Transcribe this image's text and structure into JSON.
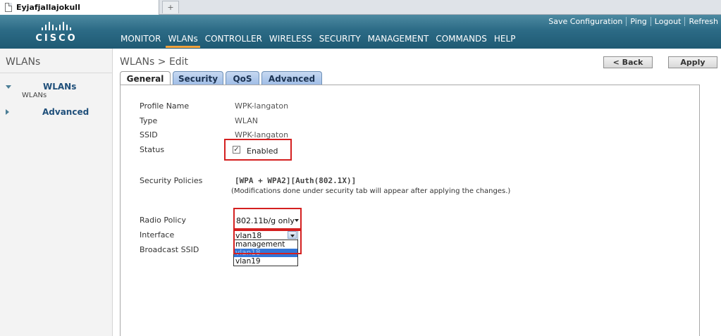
{
  "browser": {
    "tab_title": "Eyjafjallajokull",
    "new_tab_glyph": "+"
  },
  "header": {
    "logo_text": "CISCO",
    "top_links": [
      "Save Configuration",
      "Ping",
      "Logout",
      "Refresh"
    ],
    "nav": [
      "MONITOR",
      "WLANs",
      "CONTROLLER",
      "WIRELESS",
      "SECURITY",
      "MANAGEMENT",
      "COMMANDS",
      "HELP"
    ],
    "active_nav": "WLANs",
    "accent_color": "#f3a23b"
  },
  "sidebar": {
    "title": "WLANs",
    "items": [
      {
        "label": "WLANs",
        "expanded": true,
        "sub": "WLANs"
      },
      {
        "label": "Advanced",
        "expanded": false
      }
    ]
  },
  "main": {
    "breadcrumb": "WLANs > Edit",
    "back_label": "< Back",
    "apply_label": "Apply",
    "tabs": [
      "General",
      "Security",
      "QoS",
      "Advanced"
    ],
    "active_tab": "General",
    "fields": {
      "profile_name_label": "Profile Name",
      "profile_name_value": "WPK-langaton",
      "type_label": "Type",
      "type_value": "WLAN",
      "ssid_label": "SSID",
      "ssid_value": "WPK-langaton",
      "status_label": "Status",
      "status_checkbox_label": "Enabled",
      "status_checked": true,
      "security_policies_label": "Security Policies",
      "security_policies_value": "[WPA + WPA2][Auth(802.1X)]",
      "security_note": "(Modifications done under security tab will appear after applying the changes.)",
      "radio_policy_label": "Radio Policy",
      "radio_policy_value": "802.11b/g only",
      "interface_label": "Interface",
      "interface_value": "vlan18",
      "interface_options": [
        "management",
        "vlan18",
        "vlan19"
      ],
      "interface_highlighted": "vlan18",
      "broadcast_ssid_label": "Broadcast SSID"
    }
  }
}
